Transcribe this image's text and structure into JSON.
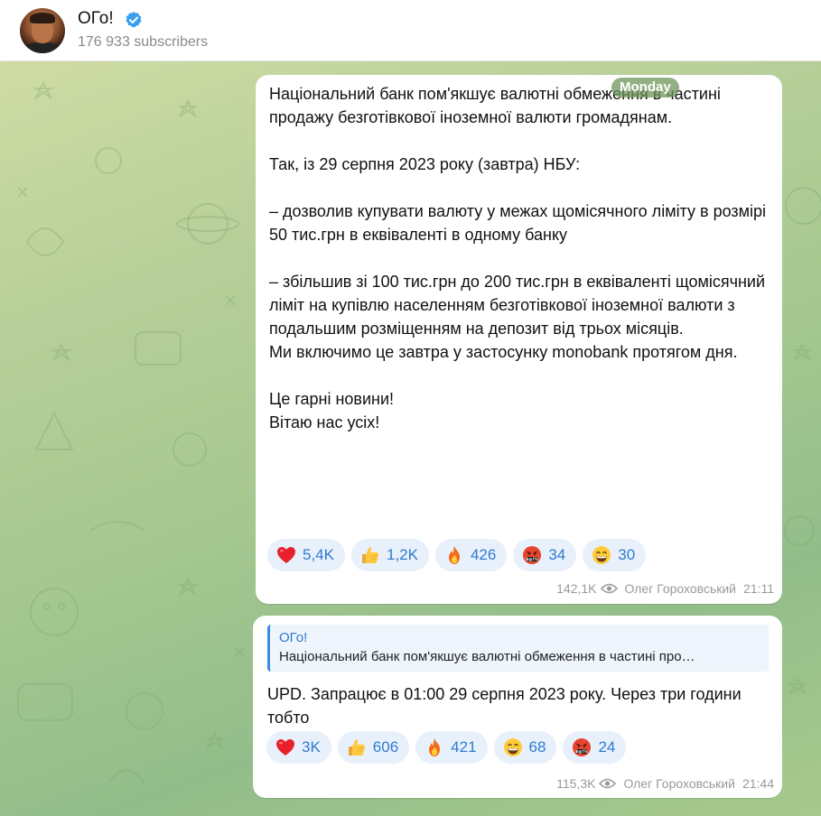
{
  "header": {
    "channel_name": "ОГо!",
    "subscribers": "176 933 subscribers"
  },
  "date_pill": "Monday",
  "messages": [
    {
      "text": "Національний банк пом'якшує валютні обмеження в частині продажу безготівкової іноземної валюти громадянам.\n\nТак, із 29 серпня 2023 року (завтра) НБУ:\n\n– дозволив купувати валюту у межах щомісячного ліміту в розмірі 50 тис.грн в еквіваленті в одному банку\n\n– збільшив зі 100 тис.грн до 200 тис.грн в еквіваленті щомісячний ліміт на купівлю населенням безготівкової іноземної валюти з подальшим розміщенням на депозит від трьох місяців.\n",
      "bold": "Ми включимо це завтра у застосунку monobank протягом дня.",
      "text_end": "Це гарні новини!\nВітаю нас усіх!",
      "reactions": [
        {
          "emoji": "heart-icon",
          "count": "5,4K"
        },
        {
          "emoji": "thumbs-up-icon",
          "count": "1,2K"
        },
        {
          "emoji": "fire-icon",
          "count": "426"
        },
        {
          "emoji": "cursing-face-icon",
          "count": "34"
        },
        {
          "emoji": "grinning-face-icon",
          "count": "30"
        }
      ],
      "views": "142,1K",
      "author": "Олег Гороховський",
      "time": "21:11"
    },
    {
      "reply_name": "ОГо!",
      "reply_text": "Національний банк пом'якшує валютні обмеження в частині про…",
      "text": "UPD. Запрацює в 01:00 29 серпня 2023 року. Через три години тобто",
      "reactions": [
        {
          "emoji": "heart-icon",
          "count": "3K"
        },
        {
          "emoji": "thumbs-up-icon",
          "count": "606"
        },
        {
          "emoji": "fire-icon",
          "count": "421"
        },
        {
          "emoji": "grinning-face-icon",
          "count": "68"
        },
        {
          "emoji": "cursing-face-icon",
          "count": "24"
        }
      ],
      "views": "115,3K",
      "author": "Олег Гороховський",
      "time": "21:44"
    }
  ],
  "colors": {
    "accent": "#2f7ad1",
    "reaction_bg": "#e8f1fb",
    "chat_bg_light": "#cfdca4",
    "chat_bg_dark": "#92bd8a"
  }
}
